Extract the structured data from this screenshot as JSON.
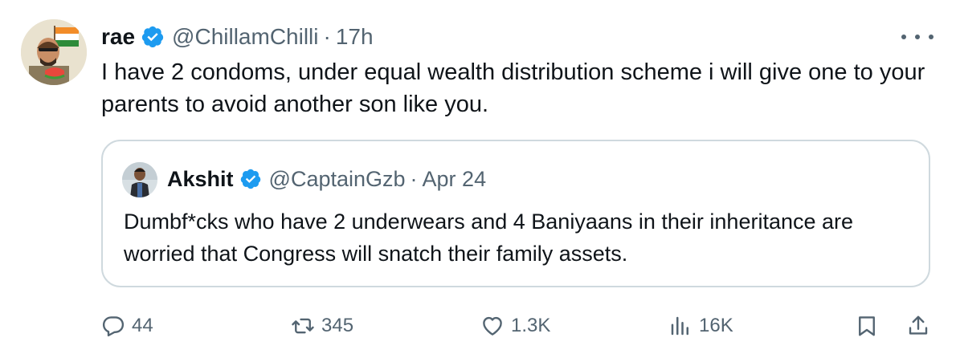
{
  "tweet": {
    "display_name": "rae",
    "handle": "@ChillamChilli",
    "separator": "·",
    "time": "17h",
    "text": "I have 2 condoms, under equal wealth distribution scheme i will give one to your parents to avoid another son like you."
  },
  "quoted_tweet": {
    "display_name": "Akshit",
    "handle": "@CaptainGzb",
    "separator": "·",
    "date": "Apr 24",
    "text": "Dumbf*cks who have 2 underwears and 4 Baniyaans in their inheritance are worried that Congress will snatch their family assets."
  },
  "actions": {
    "replies": "44",
    "reposts": "345",
    "likes": "1.3K",
    "views": "16K"
  },
  "icons": {
    "verified": "verified-badge-icon",
    "more": "more-options-icon",
    "reply": "reply-icon",
    "repost": "repost-icon",
    "like": "heart-icon",
    "views": "views-chart-icon",
    "bookmark": "bookmark-icon",
    "share": "share-icon"
  },
  "colors": {
    "verified_blue": "#1d9bf0",
    "text_primary": "#0f1419",
    "text_secondary": "#536471",
    "border": "#cfd9de"
  }
}
